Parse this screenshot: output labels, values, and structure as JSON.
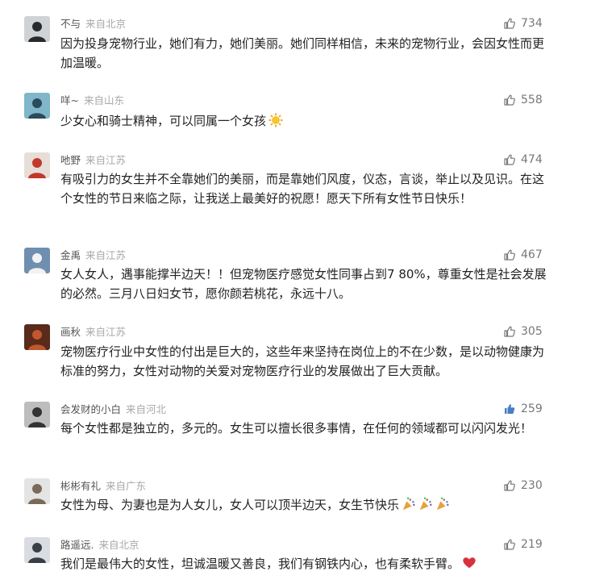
{
  "comments": [
    {
      "name": "不与",
      "location": "来自北京",
      "likes": "734",
      "liked": false,
      "text": "因为投身宠物行业，她们有力，她们美丽。她们同样相信，未来的宠物行业，会因女性而更加温暖。",
      "avatar_icon": "person-avatar",
      "avatar_colors": [
        "#cfd3d6",
        "#2a2a2a"
      ]
    },
    {
      "name": "咩~",
      "location": "来自山东",
      "likes": "558",
      "liked": false,
      "text": "少女心和骑士精神，可以同属一个女孩",
      "trailing_emoji": "sun-emoji",
      "avatar_icon": "girl-avatar",
      "avatar_colors": [
        "#7fb6c9",
        "#2b4a5a"
      ]
    },
    {
      "name": "吔野",
      "location": "来自江苏",
      "likes": "474",
      "liked": false,
      "text": "有吸引力的女生并不全靠她们的美丽，而是靠她们风度，仪态，言谈，举止以及见识。在这个女性的节日来临之际，让我送上最美好的祝愿！愿天下所有女性节日快乐！",
      "avatar_icon": "red-figure-avatar",
      "avatar_colors": [
        "#e8ded8",
        "#c0392b"
      ]
    },
    {
      "name": "金禹",
      "location": "来自江苏",
      "likes": "467",
      "liked": false,
      "text": "女人女人，遇事能撑半边天！！但宠物医疗感觉女性同事占到7 80%，尊重女性是社会发展的必然。三月八日妇女节，愿你颜若桃花，永远十八。",
      "avatar_icon": "eagle-avatar",
      "avatar_colors": [
        "#6f8fb0",
        "#f2f2f2"
      ]
    },
    {
      "name": "画秋",
      "location": "来自江苏",
      "likes": "305",
      "liked": false,
      "text": "宠物医疗行业中女性的付出是巨大的，这些年来坚持在岗位上的不在少数，是以动物健康为标准的努力，女性对动物的关爱对宠物医疗行业的发展做出了巨大贡献。",
      "avatar_icon": "autumn-avatar",
      "avatar_colors": [
        "#5a2a1a",
        "#c0582f"
      ]
    },
    {
      "name": "会发财的小白",
      "location": "来自河北",
      "likes": "259",
      "liked": true,
      "text": "每个女性都是独立的，多元的。女生可以擅长很多事情，在任何的领域都可以闪闪发光！",
      "avatar_icon": "bw-portrait-avatar",
      "avatar_colors": [
        "#bdbdbd",
        "#333333"
      ]
    },
    {
      "name": "彬彬有礼",
      "location": "来自广东",
      "likes": "230",
      "liked": false,
      "text": "女性为母、为妻也是为人女儿，女人可以顶半边天，女生节快乐",
      "trailing_emoji": "party-popper-emoji",
      "trailing_emoji_count": 3,
      "avatar_icon": "cat-avatar",
      "avatar_colors": [
        "#e4e4e4",
        "#7a6a5a"
      ]
    },
    {
      "name": "路遥远.",
      "location": "来自北京",
      "likes": "219",
      "liked": false,
      "text": "我们是最伟大的女性，坦诚温暖又善良，我们有钢铁内心，也有柔软手臂。",
      "trailing_emoji": "red-heart-emoji",
      "avatar_icon": "car-avatar",
      "avatar_colors": [
        "#d9dde2",
        "#3a3f46"
      ]
    }
  ],
  "colors": {
    "name": "#555555",
    "location": "#a8a8a8",
    "like_outline": "#777777",
    "like_filled": "#4a7ec4",
    "text": "#222222"
  }
}
